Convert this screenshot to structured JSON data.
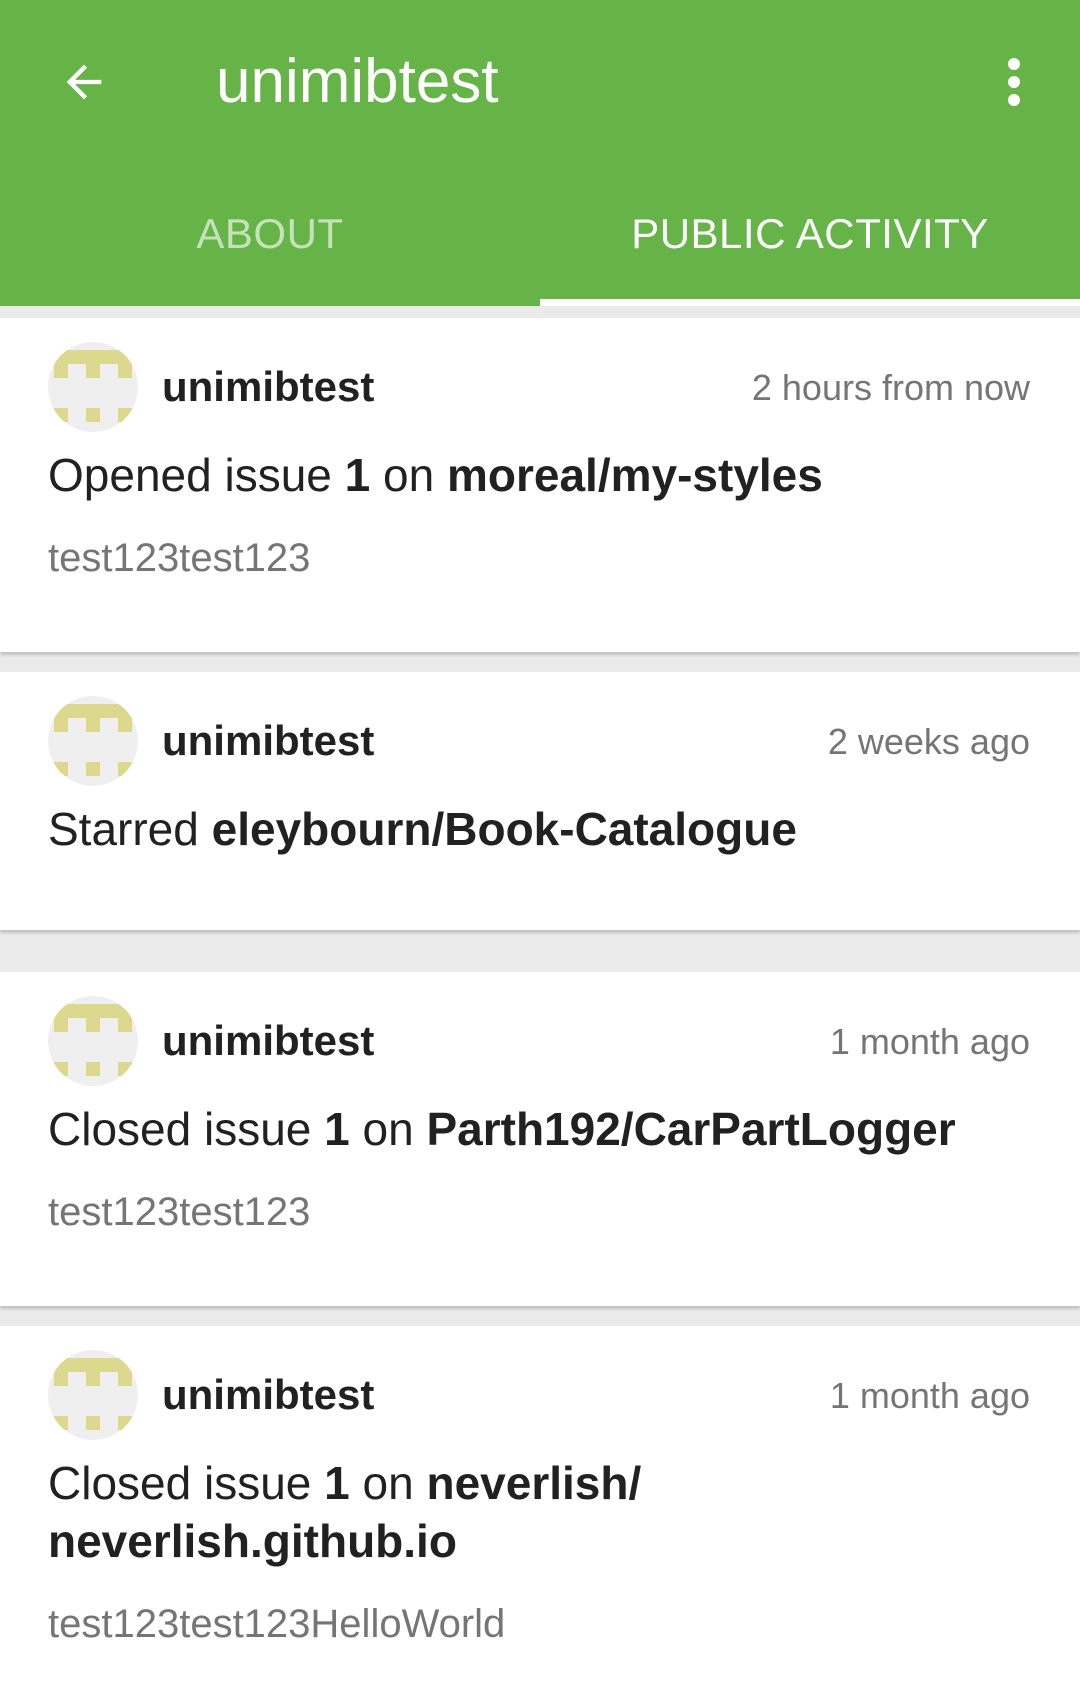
{
  "header": {
    "title": "unimibtest",
    "back_icon": "arrow-left-icon",
    "menu_icon": "more-vert-icon",
    "background": "#66b447"
  },
  "tabs": [
    {
      "label": "ABOUT",
      "active": false
    },
    {
      "label": "PUBLIC ACTIVITY",
      "active": true
    }
  ],
  "feed": [
    {
      "user": "unimibtest",
      "time": "2 hours from now",
      "action": "Opened issue",
      "number": "1",
      "on": "on",
      "repo": "moreal/my-styles",
      "detail": "test123test123"
    },
    {
      "user": "unimibtest",
      "time": "2 weeks ago",
      "action": "Starred",
      "repo": "eleybourn/Book-Catalogue"
    },
    {
      "user": "unimibtest",
      "time": "1 month ago",
      "action": "Closed issue",
      "number": "1",
      "on": "on",
      "repo": "Parth192/CarPartLogger",
      "detail": "test123test123"
    },
    {
      "user": "unimibtest",
      "time": "1 month ago",
      "action": "Closed issue",
      "number": "1",
      "on": "on",
      "repo_line1": "neverlish/",
      "repo_line2": "neverlish.github.io",
      "detail": "test123test123HelloWorld"
    }
  ],
  "avatar_color": "#dcd88e"
}
